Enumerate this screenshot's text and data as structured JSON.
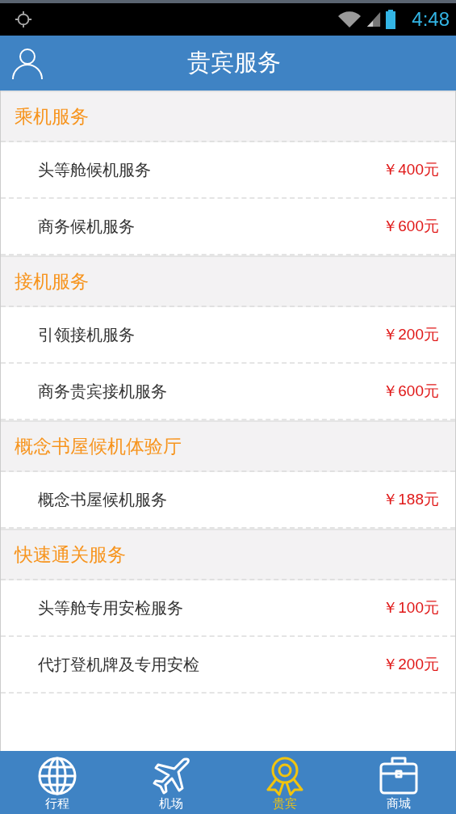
{
  "status_bar": {
    "time": "4:48"
  },
  "header": {
    "title": "贵宾服务"
  },
  "sections": [
    {
      "title": "乘机服务",
      "items": [
        {
          "name": "头等舱候机服务",
          "price": "￥400元"
        },
        {
          "name": "商务候机服务",
          "price": "￥600元"
        }
      ]
    },
    {
      "title": "接机服务",
      "items": [
        {
          "name": "引领接机服务",
          "price": "￥200元"
        },
        {
          "name": "商务贵宾接机服务",
          "price": "￥600元"
        }
      ]
    },
    {
      "title": "概念书屋候机体验厅",
      "items": [
        {
          "name": "概念书屋候机服务",
          "price": "￥188元"
        }
      ]
    },
    {
      "title": "快速通关服务",
      "items": [
        {
          "name": "头等舱专用安检服务",
          "price": "￥100元"
        },
        {
          "name": "代打登机牌及专用安检",
          "price": "￥200元"
        }
      ]
    }
  ],
  "tab_bar": [
    {
      "kind": "globe",
      "label": "行程",
      "selected": false
    },
    {
      "kind": "plane",
      "label": "机场",
      "selected": false
    },
    {
      "kind": "medal",
      "label": "贵宾",
      "selected": true
    },
    {
      "kind": "briefcase",
      "label": "商城",
      "selected": false
    }
  ]
}
